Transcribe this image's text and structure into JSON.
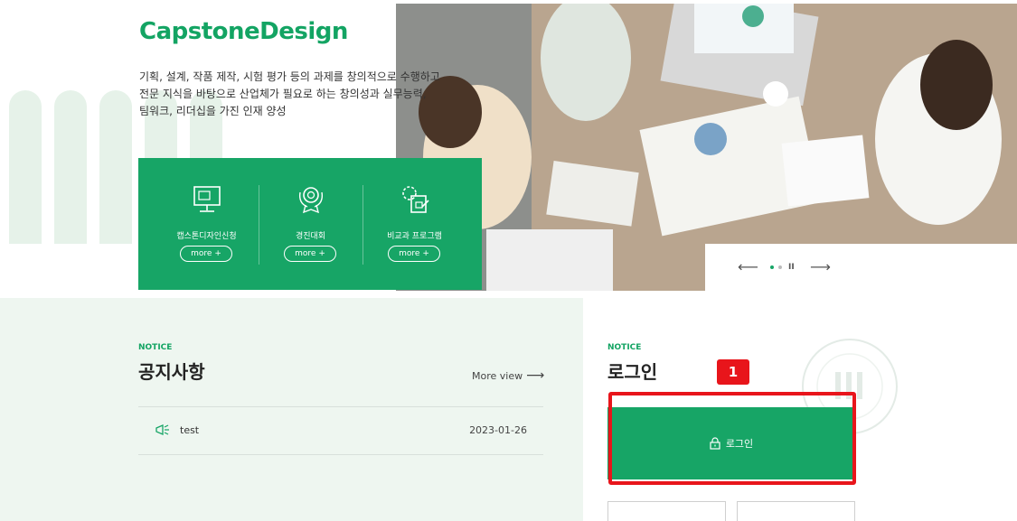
{
  "brand": "CapstoneDesign",
  "description": [
    "기획, 설계, 작품 제작, 시험 평가 등의 과제를 창의적으로 수행하고",
    "전문 지식을 바탕으로 산업체가 필요로 하는 창의성과 실무능력,",
    "팀워크, 리더십을 가진 인재 양성"
  ],
  "quick_menu": [
    {
      "label": "캡스톤디자인신청",
      "more": "more +",
      "icon": "monitor-icon"
    },
    {
      "label": "경진대회",
      "more": "more +",
      "icon": "trophy-icon"
    },
    {
      "label": "비교과 프로그램",
      "more": "more +",
      "icon": "gear-document-icon"
    }
  ],
  "slider": {
    "prev": "⟵",
    "pause": "II",
    "next": "⟶"
  },
  "notice": {
    "tag": "NOTICE",
    "title": "공지사항",
    "more_view": "More view",
    "more_arrow": "⟶",
    "items": [
      {
        "title": "test",
        "date": "2023-01-26"
      }
    ]
  },
  "login": {
    "tag": "NOTICE",
    "title": "로그인",
    "button_label": "로그인"
  },
  "annotation": {
    "badge": "1"
  },
  "colors": {
    "brand_green": "#17a566",
    "highlight_red": "#e8151b"
  }
}
